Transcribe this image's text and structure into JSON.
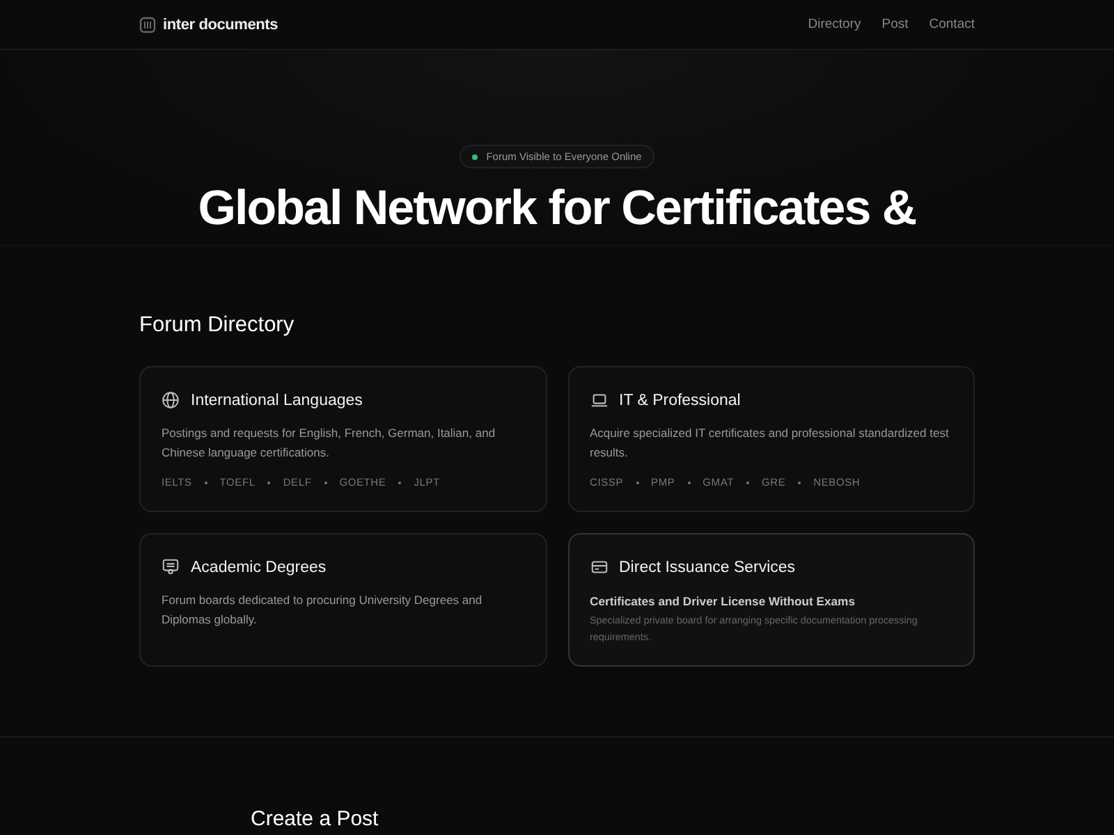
{
  "nav": {
    "brand": "inter documents",
    "links": [
      "Directory",
      "Post",
      "Contact"
    ]
  },
  "hero": {
    "badge": {
      "label": "Forum Visible to Everyone Online",
      "color": "#3fb67a"
    },
    "heading": "Global Network for Certificates &"
  },
  "directory": {
    "title": "Forum Directory",
    "cards": [
      {
        "kind": "tags",
        "title": "International Languages",
        "description": "Postings and requests for English, French, German, Italian, and Chinese language certifications.",
        "tags": [
          "IELTS",
          "TOEFL",
          "DELF",
          "GOETHE",
          "JLPT"
        ]
      },
      {
        "kind": "tags",
        "title": "IT & Professional",
        "description": "Acquire specialized IT certificates and professional standardized test results.",
        "tags": [
          "CISSP",
          "PMP",
          "GMAT",
          "GRE",
          "NEBOSH"
        ]
      },
      {
        "kind": "plain",
        "title": "Academic Degrees",
        "description": "Forum boards dedicated to procuring University Degrees and Diplomas globally."
      },
      {
        "kind": "featured",
        "title": "Direct Issuance Services",
        "subtitle": "Certificates and Driver License Without Exams",
        "description": "Specialized private board for arranging specific documentation processing requirements."
      }
    ]
  },
  "post_section": {
    "title": "Create a Post"
  }
}
